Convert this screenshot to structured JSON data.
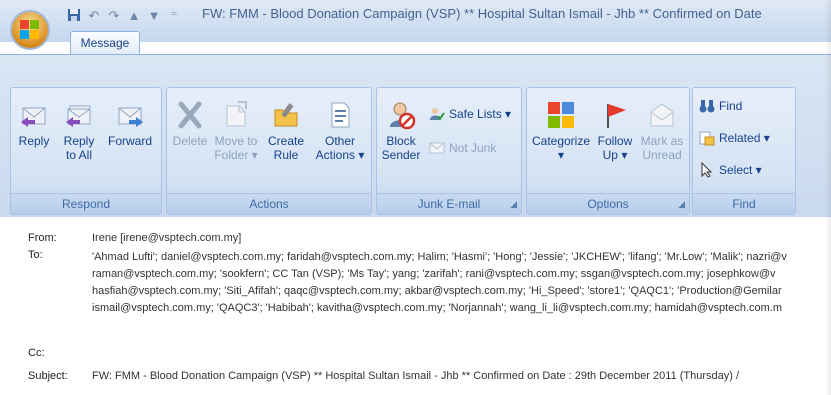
{
  "window": {
    "title": "FW: FMM - Blood Donation Campaign (VSP)  ** Hospital Sultan Ismail - Jhb **  Confirmed on Date"
  },
  "quick_access": {
    "icons": [
      "save-icon",
      "undo-icon",
      "redo-icon",
      "previous-icon",
      "next-icon",
      "customize-icon"
    ]
  },
  "tabs": [
    {
      "label": "Message"
    }
  ],
  "ribbon": {
    "respond": {
      "label": "Respond",
      "reply": "Reply",
      "reply_all_1": "Reply",
      "reply_all_2": "to All",
      "forward": "Forward"
    },
    "actions": {
      "label": "Actions",
      "delete": "Delete",
      "move_1": "Move to",
      "move_2": "Folder ▾",
      "create_1": "Create",
      "create_2": "Rule",
      "other_1": "Other",
      "other_2": "Actions ▾"
    },
    "junk": {
      "label": "Junk E-mail",
      "block_1": "Block",
      "block_2": "Sender",
      "safe_lists": "Safe Lists ▾",
      "not_junk": "Not Junk"
    },
    "options": {
      "label": "Options",
      "categorize": "Categorize",
      "categorize_2": "▾",
      "follow_1": "Follow",
      "follow_2": "Up ▾",
      "mark_1": "Mark as",
      "mark_2": "Unread"
    },
    "find": {
      "label": "Find",
      "find": "Find",
      "related": "Related ▾",
      "select": "Select ▾"
    }
  },
  "message": {
    "from_label": "From:",
    "from": "Irene [irene@vsptech.com.my]",
    "to_label": "To:",
    "to_lines": [
      "'Ahmad Lufti'; daniel@vsptech.com.my; faridah@vsptech.com.my; Halim; 'Hasmi'; 'Hong'; 'Jessie'; 'JKCHEW'; 'lifang'; 'Mr.Low'; 'Malik'; nazri@v",
      "raman@vsptech.com.my; 'sookfern'; CC Tan (VSP); 'Ms Tay'; yang; 'zarifah'; rani@vsptech.com.my; ssgan@vsptech.com.my; josephkow@v",
      "hasfiah@vsptech.com.my; 'Siti_Afifah'; qaqc@vsptech.com.my; akbar@vsptech.com.my; 'Hi_Speed'; 'store1'; 'QAQC1'; 'Production@Gemilar",
      "ismail@vsptech.com.my; 'QAQC3'; 'Habibah'; kavitha@vsptech.com.my; 'Norjannah'; wang_li_li@vsptech.com.my; hamidah@vsptech.com.m"
    ],
    "cc_label": "Cc:",
    "cc": "",
    "subject_label": "Subject:",
    "subject": "FW: FMM - Blood Donation Campaign (VSP)  ** Hospital Sultan Ismail - Jhb **  Confirmed on Date : 29th December 2011 (Thursday) /"
  },
  "colors": {
    "ribbon_bg": "#c9d9ee",
    "text": "#15428b",
    "disabled": "#8da2be"
  }
}
